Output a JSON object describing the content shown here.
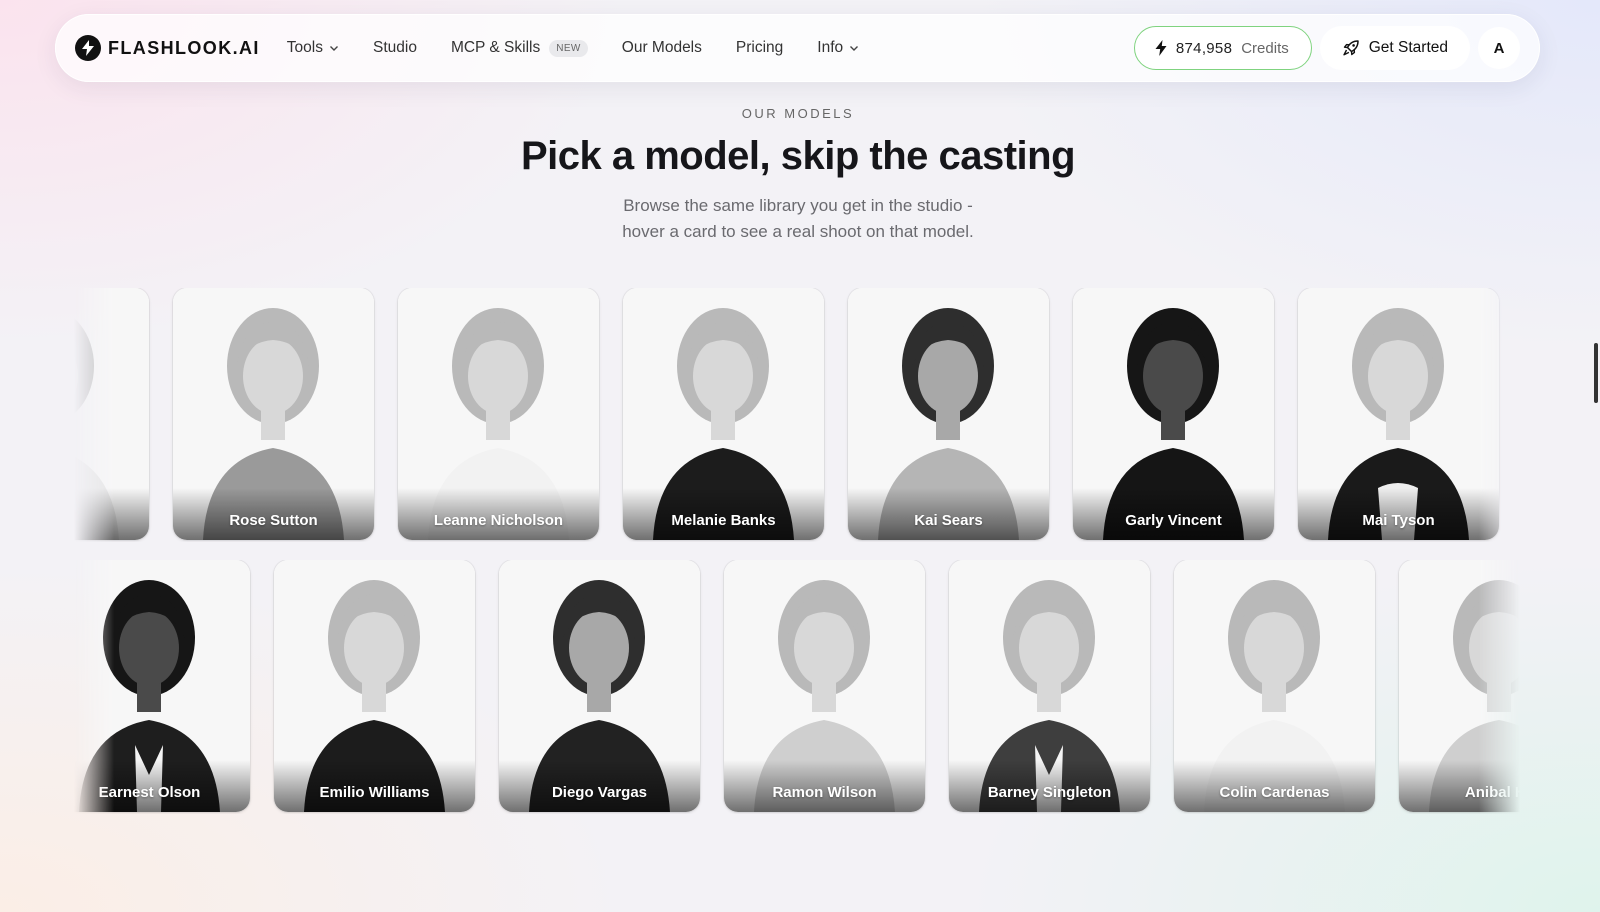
{
  "nav": {
    "logo_text": "FLASHLOOK.AI",
    "links": [
      {
        "label": "Tools",
        "has_dropdown": true
      },
      {
        "label": "Studio",
        "has_dropdown": false
      },
      {
        "label": "MCP & Skills",
        "has_dropdown": false,
        "badge": "NEW"
      },
      {
        "label": "Our Models",
        "has_dropdown": false
      },
      {
        "label": "Pricing",
        "has_dropdown": false
      },
      {
        "label": "Info",
        "has_dropdown": true
      }
    ],
    "credits": {
      "value": "874,958",
      "label": "Credits",
      "icon": "bolt-icon"
    },
    "get_started": {
      "label": "Get Started",
      "icon": "rocket-icon"
    },
    "avatar_initial": "A"
  },
  "section": {
    "eyebrow": "OUR MODELS",
    "title": "Pick a model, skip the casting",
    "subtitle_line1": "Browse the same library you get in the studio -",
    "subtitle_line2": "hover a card to see a real shoot on that model."
  },
  "models_row_1": [
    {
      "name": "",
      "tone": "light",
      "outfit": "light",
      "partial": true
    },
    {
      "name": "Rose Sutton",
      "tone": "light",
      "outfit": "shirt-grey"
    },
    {
      "name": "Leanne Nicholson",
      "tone": "light",
      "outfit": "white"
    },
    {
      "name": "Melanie Banks",
      "tone": "light",
      "outfit": "black-tank"
    },
    {
      "name": "Kai Sears",
      "tone": "mid",
      "outfit": "satin"
    },
    {
      "name": "Garly Vincent",
      "tone": "dark",
      "outfit": "black-top"
    },
    {
      "name": "Mai Tyson",
      "tone": "light",
      "outfit": "blazer-white"
    },
    {
      "name": "",
      "tone": "light",
      "outfit": "light",
      "partial": true
    }
  ],
  "models_row_2": [
    {
      "name": "Earnest Olson",
      "tone": "dark",
      "outfit": "suit"
    },
    {
      "name": "Emilio Williams",
      "tone": "light",
      "outfit": "black-tank"
    },
    {
      "name": "Diego Vargas",
      "tone": "mid",
      "outfit": "black-polo"
    },
    {
      "name": "Ramon Wilson",
      "tone": "light",
      "outfit": "light-shirt"
    },
    {
      "name": "Barney Singleton",
      "tone": "light",
      "outfit": "tweed"
    },
    {
      "name": "Colin Cardenas",
      "tone": "light",
      "outfit": "white"
    },
    {
      "name": "Anibal Ha",
      "tone": "light",
      "outfit": "light-shirt",
      "partial": true
    }
  ]
}
